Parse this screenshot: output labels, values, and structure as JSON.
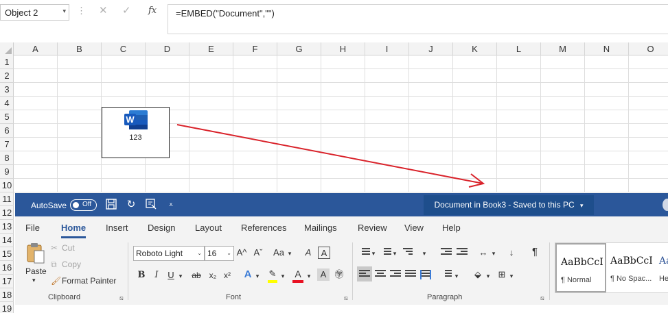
{
  "formula_bar": {
    "name_box": "Object 2",
    "name_box_arrow": "▾",
    "separator": "⋮",
    "cancel_icon": "✕",
    "enter_icon": "✓",
    "fx_label": "fx",
    "formula": "=EMBED(\"Document\",\"\")"
  },
  "sheet": {
    "columns": [
      "A",
      "B",
      "C",
      "D",
      "E",
      "F",
      "G",
      "H",
      "I",
      "J",
      "K",
      "L",
      "M",
      "N",
      "O"
    ],
    "rows": [
      "1",
      "2",
      "3",
      "4",
      "5",
      "6",
      "7",
      "8",
      "9",
      "10",
      "11",
      "12",
      "13",
      "14",
      "15",
      "16",
      "17",
      "18",
      "19"
    ],
    "embedded_object": {
      "caption": "123",
      "icon": "word-icon",
      "icon_letter": "W"
    },
    "annotation_color": "#d9222a"
  },
  "word": {
    "autosave_label": "AutoSave",
    "autosave_state": "Off",
    "quick_access_icons": [
      "save-icon",
      "redo-icon",
      "touch-mode-icon",
      "customize-qat-icon"
    ],
    "quick_access_glyphs": [
      "",
      "↻",
      "",
      "⩡"
    ],
    "doc_title": "Document in Book3",
    "title_separator": "-",
    "save_status": "Saved to this PC",
    "title_arrow": "▾",
    "accent_color": "#2b579a",
    "tabs": [
      "File",
      "Home",
      "Insert",
      "Design",
      "Layout",
      "References",
      "Mailings",
      "Review",
      "View",
      "Help"
    ],
    "active_tab": "Home",
    "clipboard": {
      "group_label": "Clipboard",
      "paste_label": "Paste",
      "paste_arrow": "▾",
      "cut_label": "Cut",
      "copy_label": "Copy",
      "format_painter_label": "Format Painter",
      "cut_glyph": "✂",
      "copy_glyph": "⧉",
      "format_painter_glyph": "🖌",
      "launcher": "⧅"
    },
    "font": {
      "group_label": "Font",
      "font_name": "Roboto Light",
      "font_size": "16",
      "combo_arrow": "⌄",
      "grow_glyph": "A^",
      "shrink_glyph": "Aˇ",
      "case_glyph": "Aa",
      "case_arrow": "▾",
      "clear_glyph": "A",
      "charborder_glyph": "A",
      "bold": "B",
      "italic": "I",
      "underline": "U",
      "underline_arrow": "▾",
      "strikethrough": "ab",
      "subscript": "x₂",
      "superscript": "x²",
      "text_effect": "A",
      "highlight_glyph": "✎",
      "font_color_glyph": "A",
      "shading_glyph": "A",
      "phonetic_glyph": "㊫",
      "highlight_color": "#ffff00",
      "font_color": "#e81123",
      "launcher": "⧅"
    },
    "paragraph": {
      "group_label": "Paragraph",
      "sort_glyph": "↓",
      "pilcrow_glyph": "¶",
      "asian_layout_glyph": "↔",
      "arrow_glyph": "▾",
      "shading_glyph": "⬙",
      "border_glyph": "⊞",
      "launcher": "⧅"
    },
    "styles": [
      {
        "sample": "AaBbCcI",
        "name": "¶ Normal"
      },
      {
        "sample": "AaBbCcI",
        "name": "¶ No Spac..."
      },
      {
        "sample": "Aa",
        "name": "He"
      }
    ]
  }
}
